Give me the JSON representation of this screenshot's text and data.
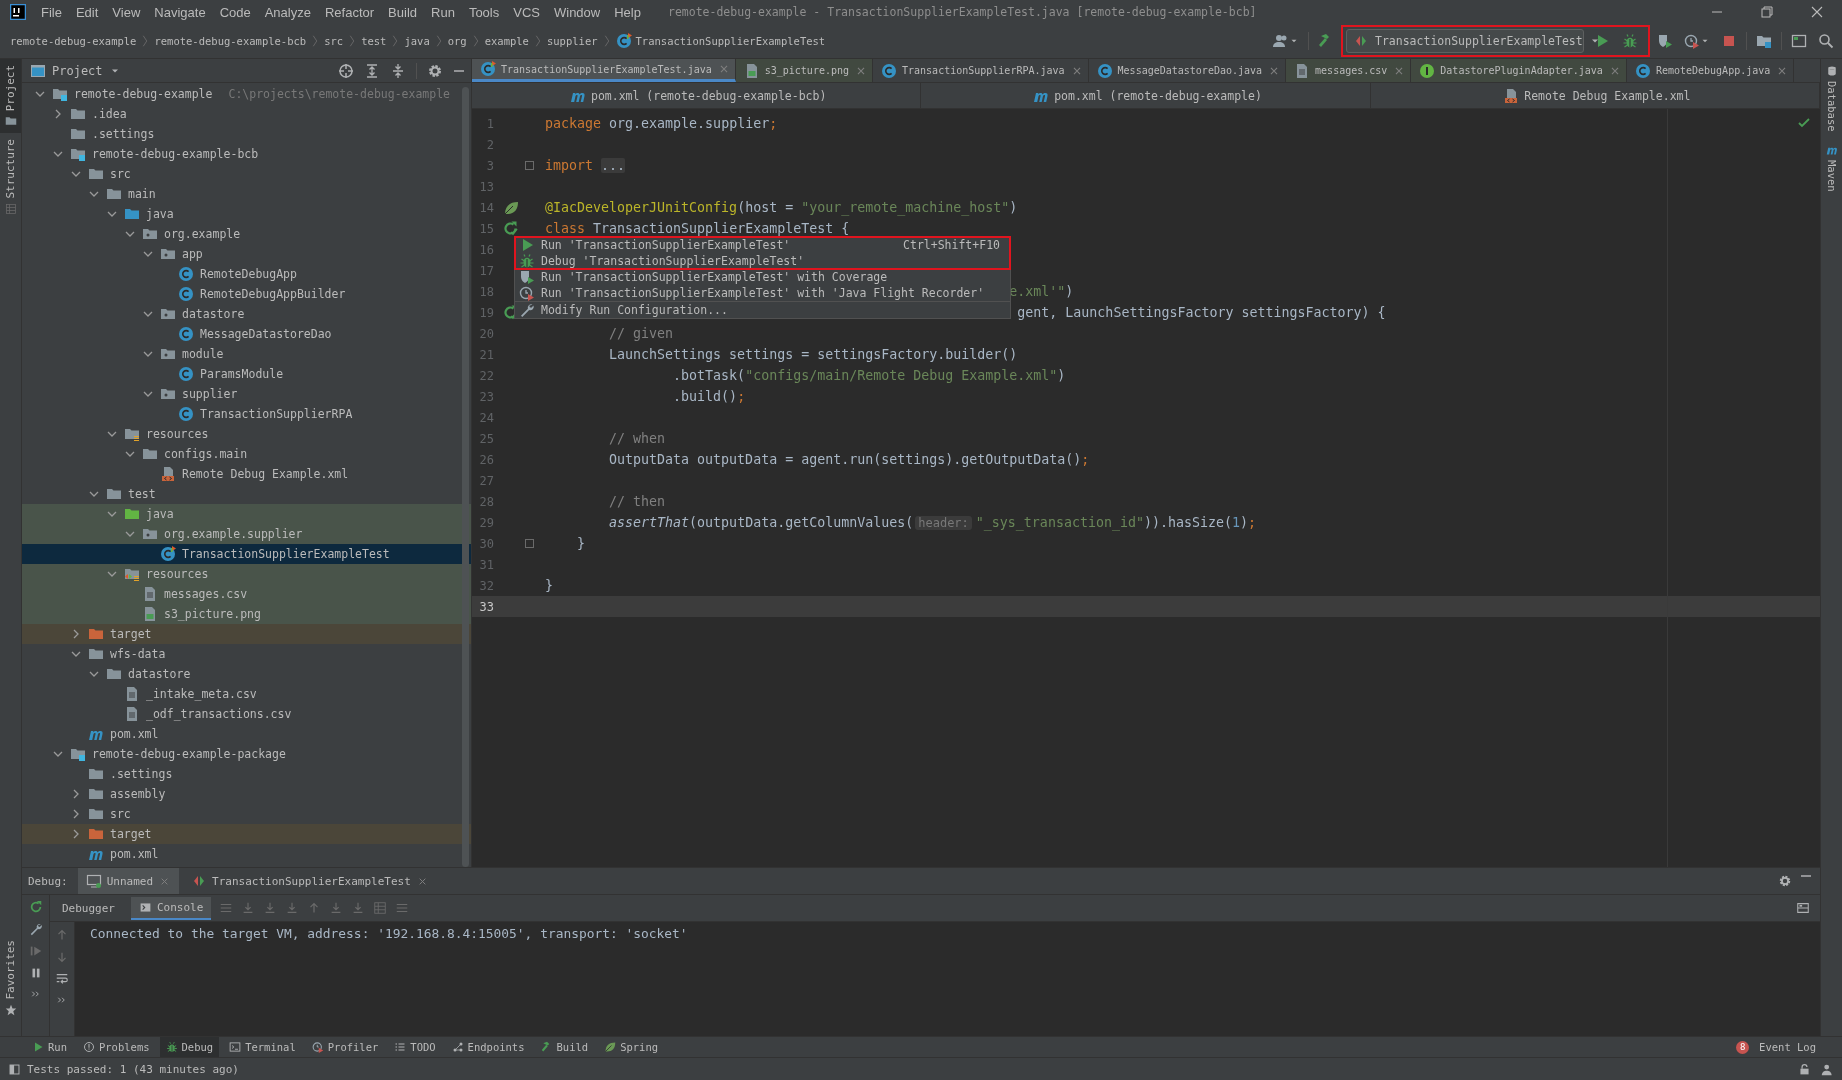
{
  "titlebar": {
    "menu": [
      "File",
      "Edit",
      "View",
      "Navigate",
      "Code",
      "Analyze",
      "Refactor",
      "Build",
      "Run",
      "Tools",
      "VCS",
      "Window",
      "Help"
    ],
    "title": "remote-debug-example - TransactionSupplierExampleTest.java [remote-debug-example-bcb]"
  },
  "navbar": {
    "breadcrumbs": [
      {
        "label": "remote-debug-example"
      },
      {
        "label": "remote-debug-example-bcb"
      },
      {
        "label": "src"
      },
      {
        "label": "test"
      },
      {
        "label": "java"
      },
      {
        "label": "org"
      },
      {
        "label": "example"
      },
      {
        "label": "supplier"
      },
      {
        "label": "TransactionSupplierExampleTest",
        "kind": "test-class"
      }
    ],
    "run_configuration": {
      "label": "TransactionSupplierExampleTest",
      "highlighted": true
    }
  },
  "left_stripe": {
    "tabs": [
      {
        "label": "Project",
        "selected": true
      },
      {
        "label": "Structure",
        "selected": false
      }
    ],
    "bottom": [
      {
        "label": "Favorites"
      }
    ]
  },
  "project": {
    "title": "Project",
    "tree": [
      {
        "label": "remote-debug-example",
        "kind": "module",
        "expanded": true,
        "selected": false,
        "note": "C:\\projects\\remote-debug-example",
        "children": [
          {
            "label": ".idea",
            "kind": "folder",
            "expanded": false,
            "selected": false
          },
          {
            "label": ".settings",
            "kind": "folder",
            "selected": false
          },
          {
            "label": "remote-debug-example-bcb",
            "kind": "module",
            "expanded": true,
            "selected": false,
            "children": [
              {
                "label": "src",
                "kind": "folder",
                "expanded": true,
                "selected": false,
                "children": [
                  {
                    "label": "main",
                    "kind": "folder",
                    "expanded": true,
                    "selected": false,
                    "children": [
                      {
                        "label": "java",
                        "kind": "source",
                        "expanded": true,
                        "selected": false,
                        "children": [
                          {
                            "label": "org.example",
                            "kind": "package",
                            "expanded": true,
                            "selected": false,
                            "children": [
                              {
                                "label": "app",
                                "kind": "package",
                                "expanded": true,
                                "selected": false,
                                "children": [
                                  {
                                    "label": "RemoteDebugApp",
                                    "kind": "class",
                                    "selected": false
                                  },
                                  {
                                    "label": "RemoteDebugAppBuilder",
                                    "kind": "class",
                                    "selected": false
                                  }
                                ]
                              },
                              {
                                "label": "datastore",
                                "kind": "package",
                                "expanded": true,
                                "selected": false,
                                "children": [
                                  {
                                    "label": "MessageDatastoreDao",
                                    "kind": "class",
                                    "selected": false
                                  }
                                ]
                              },
                              {
                                "label": "module",
                                "kind": "package",
                                "expanded": true,
                                "selected": false,
                                "children": [
                                  {
                                    "label": "ParamsModule",
                                    "kind": "class",
                                    "selected": false
                                  }
                                ]
                              },
                              {
                                "label": "supplier",
                                "kind": "package",
                                "expanded": true,
                                "selected": false,
                                "children": [
                                  {
                                    "label": "TransactionSupplierRPA",
                                    "kind": "class",
                                    "selected": false
                                  }
                                ]
                              }
                            ]
                          }
                        ]
                      },
                      {
                        "label": "resources",
                        "kind": "resources",
                        "expanded": true,
                        "selected": false,
                        "children": [
                          {
                            "label": "configs.main",
                            "kind": "folder",
                            "expanded": true,
                            "selected": false,
                            "children": [
                              {
                                "label": "Remote Debug Example.xml",
                                "kind": "xml",
                                "selected": false
                              }
                            ]
                          }
                        ]
                      }
                    ]
                  },
                  {
                    "label": "test",
                    "kind": "folder",
                    "expanded": true,
                    "selected": false,
                    "children": [
                      {
                        "label": "java",
                        "kind": "test-source",
                        "expanded": true,
                        "selected": false,
                        "color": "#49544a",
                        "children": [
                          {
                            "label": "org.example.supplier",
                            "kind": "package",
                            "expanded": true,
                            "selected": false,
                            "color": "#49544a",
                            "children": [
                              {
                                "label": "TransactionSupplierExampleTest",
                                "kind": "test-class",
                                "selected": true
                              }
                            ]
                          }
                        ]
                      },
                      {
                        "label": "resources",
                        "kind": "test-resources",
                        "expanded": true,
                        "selected": false,
                        "color": "#49544a",
                        "children": [
                          {
                            "label": "messages.csv",
                            "kind": "file",
                            "selected": false,
                            "color": "#49544a"
                          },
                          {
                            "label": "s3_picture.png",
                            "kind": "image",
                            "selected": false,
                            "color": "#49544a"
                          }
                        ]
                      }
                    ]
                  }
                ]
              },
              {
                "label": "target",
                "kind": "excluded",
                "expanded": false,
                "selected": false,
                "color": "#4b4639"
              },
              {
                "label": "wfs-data",
                "kind": "folder",
                "expanded": true,
                "selected": false,
                "children": [
                  {
                    "label": "datastore",
                    "kind": "folder",
                    "expanded": true,
                    "selected": false,
                    "children": [
                      {
                        "label": "_intake_meta.csv",
                        "kind": "file",
                        "selected": false
                      },
                      {
                        "label": "_odf_transactions.csv",
                        "kind": "file",
                        "selected": false
                      }
                    ]
                  }
                ]
              },
              {
                "label": "pom.xml",
                "kind": "maven",
                "selected": false
              }
            ]
          },
          {
            "label": "remote-debug-example-package",
            "kind": "module",
            "expanded": true,
            "selected": false,
            "children": [
              {
                "label": ".settings",
                "kind": "folder",
                "selected": false
              },
              {
                "label": "assembly",
                "kind": "folder",
                "expanded": false,
                "selected": false
              },
              {
                "label": "src",
                "kind": "folder",
                "expanded": false,
                "selected": false
              },
              {
                "label": "target",
                "kind": "excluded",
                "expanded": false,
                "selected": false,
                "color": "#4b4639"
              },
              {
                "label": "pom.xml",
                "kind": "maven",
                "selected": false
              }
            ]
          }
        ]
      }
    ]
  },
  "editor": {
    "tabs": [
      {
        "label": "TransactionSupplierExampleTest.java",
        "kind": "test-class",
        "selected": true
      },
      {
        "label": "s3_picture.png",
        "kind": "image",
        "selected": false,
        "color": "#414940"
      },
      {
        "label": "TransactionSupplierRPA.java",
        "kind": "class",
        "selected": false
      },
      {
        "label": "MessageDatastoreDao.java",
        "kind": "class",
        "selected": false
      },
      {
        "label": "messages.csv",
        "kind": "file",
        "selected": false,
        "color": "#414940"
      },
      {
        "label": "DatastorePluginAdapter.java",
        "kind": "interface",
        "selected": false,
        "color": "#414940"
      },
      {
        "label": "RemoteDebugApp.java",
        "kind": "class",
        "selected": false
      }
    ],
    "second_row_tabs": [
      {
        "label": "pom.xml (remote-debug-example-bcb)",
        "kind": "maven",
        "selected": false
      },
      {
        "label": "pom.xml (remote-debug-example)",
        "kind": "maven",
        "selected": false
      },
      {
        "label": "Remote Debug Example.xml",
        "kind": "xml",
        "selected": false
      }
    ],
    "lines": [
      {
        "number": "1",
        "kind": "plain",
        "current": false,
        "tokens": [
          {
            "kind": "keyword",
            "text": "package"
          },
          {
            "kind": "plain",
            "text": " org.example.supplier"
          },
          {
            "kind": "keyword",
            "text": ";"
          }
        ]
      },
      {
        "number": "2",
        "kind": "plain",
        "current": false
      },
      {
        "number": "3",
        "kind": "fold-start",
        "current": false,
        "tokens": [
          {
            "kind": "keyword",
            "text": "import"
          },
          {
            "kind": "folded",
            "text": "..."
          }
        ]
      },
      {
        "number": "13",
        "kind": "plain",
        "current": false
      },
      {
        "number": "14",
        "kind": "bean",
        "current": false,
        "tokens": [
          {
            "kind": "annotation",
            "text": "@IacDeveloperJUnitConfig"
          },
          {
            "kind": "plain",
            "text": "(host = "
          },
          {
            "kind": "string",
            "text": "\"your_remote_machine_host\""
          },
          {
            "kind": "plain",
            "text": ")"
          }
        ]
      },
      {
        "number": "15",
        "kind": "run",
        "current": false,
        "tokens": [
          {
            "kind": "keyword",
            "text": "class"
          },
          {
            "kind": "plain",
            "text": " TransactionSupplierExampleTest {"
          }
        ]
      },
      {
        "number": "16",
        "kind": "plain",
        "current": false
      },
      {
        "number": "17",
        "kind": "plain",
        "current": false
      },
      {
        "number": "18",
        "kind": "plain",
        "current": false,
        "tokens": [
          {
            "kind": "string",
            "text": "                                                          e.xml'\""
          },
          {
            "kind": "plain",
            "text": ")"
          }
        ]
      },
      {
        "number": "19",
        "kind": "run",
        "current": false,
        "tokens": [
          {
            "kind": "plain",
            "text": "                                                           gent, LaunchSettingsFactory settingsFactory) {"
          }
        ]
      },
      {
        "number": "20",
        "kind": "plain",
        "current": false,
        "tokens": [
          {
            "kind": "comment",
            "text": "        // given"
          }
        ]
      },
      {
        "number": "21",
        "kind": "plain",
        "current": false,
        "tokens": [
          {
            "kind": "plain",
            "text": "        LaunchSettings settings = settingsFactory.builder()"
          }
        ]
      },
      {
        "number": "22",
        "kind": "plain",
        "current": false,
        "tokens": [
          {
            "kind": "plain",
            "text": "                .botTask("
          },
          {
            "kind": "string",
            "text": "\"configs/main/Remote Debug Example.xml\""
          },
          {
            "kind": "plain",
            "text": ")"
          }
        ]
      },
      {
        "number": "23",
        "kind": "plain",
        "current": false,
        "tokens": [
          {
            "kind": "plain",
            "text": "                .build()"
          },
          {
            "kind": "keyword",
            "text": ";"
          }
        ]
      },
      {
        "number": "24",
        "kind": "plain",
        "current": false
      },
      {
        "number": "25",
        "kind": "plain",
        "current": false,
        "tokens": [
          {
            "kind": "comment",
            "text": "        // when"
          }
        ]
      },
      {
        "number": "26",
        "kind": "plain",
        "current": false,
        "tokens": [
          {
            "kind": "plain",
            "text": "        OutputData outputData = agent.run(settings).getOutputData()"
          },
          {
            "kind": "keyword",
            "text": ";"
          }
        ]
      },
      {
        "number": "27",
        "kind": "plain",
        "current": false
      },
      {
        "number": "28",
        "kind": "plain",
        "current": false,
        "tokens": [
          {
            "kind": "comment",
            "text": "        // then"
          }
        ]
      },
      {
        "number": "29",
        "kind": "plain",
        "current": false,
        "tokens": [
          {
            "kind": "italic",
            "text": "        assertThat"
          },
          {
            "kind": "plain",
            "text": "(outputData.getColumnValues("
          },
          {
            "kind": "hint",
            "text": "header:"
          },
          {
            "kind": "string",
            "text": "\"_sys_transaction_id\""
          },
          {
            "kind": "plain",
            "text": ")).hasSize("
          },
          {
            "kind": "number",
            "text": "1"
          },
          {
            "kind": "plain",
            "text": ")"
          },
          {
            "kind": "keyword",
            "text": ";"
          }
        ]
      },
      {
        "number": "30",
        "kind": "fold-end",
        "current": false,
        "tokens": [
          {
            "kind": "plain",
            "text": "    }"
          }
        ]
      },
      {
        "number": "31",
        "kind": "plain",
        "current": false
      },
      {
        "number": "32",
        "kind": "plain",
        "current": false,
        "tokens": [
          {
            "kind": "plain",
            "text": "}"
          }
        ]
      },
      {
        "number": "33",
        "kind": "plain",
        "current": true
      }
    ],
    "popup": {
      "items": [
        {
          "label": "Run 'TransactionSupplierExampleTest'",
          "shortcut": "Ctrl+Shift+F10",
          "kind": "run",
          "highlighted": true
        },
        {
          "label": "Debug 'TransactionSupplierExampleTest'",
          "kind": "debug",
          "highlighted": true
        },
        {
          "label": "Run 'TransactionSupplierExampleTest' with Coverage",
          "kind": "coverage",
          "highlighted": false
        },
        {
          "label": "Run 'TransactionSupplierExampleTest' with 'Java Flight Recorder'",
          "kind": "profiler",
          "highlighted": false
        },
        {
          "label": "Modify Run Configuration...",
          "kind": "wrench",
          "highlighted": false
        }
      ]
    }
  },
  "right_stripe": {
    "tabs": [
      {
        "label": "Database",
        "kind": "database"
      },
      {
        "label": "Maven",
        "kind": "maven"
      }
    ]
  },
  "debug": {
    "title": "Debug:",
    "sessions": [
      {
        "label": "Unnamed",
        "selected": true
      },
      {
        "label": "TransactionSupplierExampleTest",
        "selected": false
      }
    ],
    "tabs": [
      {
        "label": "Debugger",
        "selected": false
      },
      {
        "label": "Console",
        "selected": true
      }
    ],
    "console": [
      "Connected to the target VM, address: '192.168.8.4:15005', transport: 'socket'"
    ]
  },
  "tool_windows": {
    "items": [
      {
        "label": "Run",
        "kind": "run",
        "selected": false
      },
      {
        "label": "Problems",
        "kind": "problems",
        "selected": false
      },
      {
        "label": "Debug",
        "kind": "debug",
        "selected": true
      },
      {
        "label": "Terminal",
        "kind": "terminal",
        "selected": false
      },
      {
        "label": "Profiler",
        "kind": "profiler",
        "selected": false
      },
      {
        "label": "TODO",
        "kind": "todo",
        "selected": false
      },
      {
        "label": "Endpoints",
        "kind": "endpoints",
        "selected": false
      },
      {
        "label": "Build",
        "kind": "hammer",
        "selected": false
      },
      {
        "label": "Spring",
        "kind": "leaf",
        "selected": false
      }
    ],
    "event_log": {
      "label": "Event Log",
      "badge": "8"
    }
  },
  "status_bar": {
    "text": "Tests passed: 1 (43 minutes ago)"
  }
}
